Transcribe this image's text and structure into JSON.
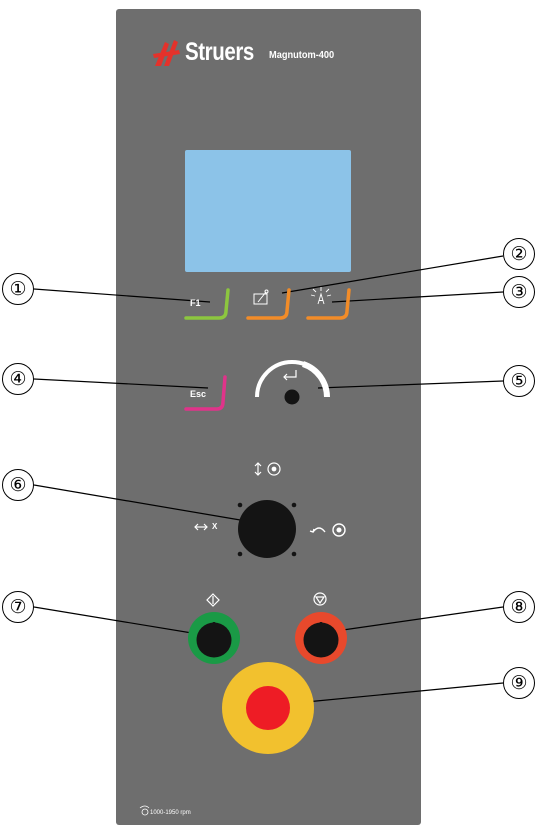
{
  "brand": {
    "name": "Struers",
    "model": "Magnutom-400"
  },
  "keys": {
    "f1_label": "F1",
    "esc_label": "Esc"
  },
  "jog": {
    "x_label": "X"
  },
  "footer": {
    "speed_text": "1000-1950 rpm"
  },
  "callouts": [
    "①",
    "②",
    "③",
    "④",
    "⑤",
    "⑥",
    "⑦",
    "⑧",
    "⑨"
  ],
  "colors": {
    "panel": "#6e6e6e",
    "display": "#8cc3e8",
    "f1_key": "#8cc63f",
    "function_keys": "#f28c28",
    "esc_key": "#e0338a",
    "start_ring": "#1a9a46",
    "stop_ring": "#e8492c",
    "estop_ring": "#f2c12e",
    "estop_button": "#ee1c25",
    "logo": "#e4322b"
  },
  "icons": [
    "wrench-setup-icon",
    "light-icon",
    "enter-icon",
    "move-vertical-icon",
    "move-horizontal-icon",
    "rotate-icon",
    "start-icon",
    "stop-icon"
  ]
}
